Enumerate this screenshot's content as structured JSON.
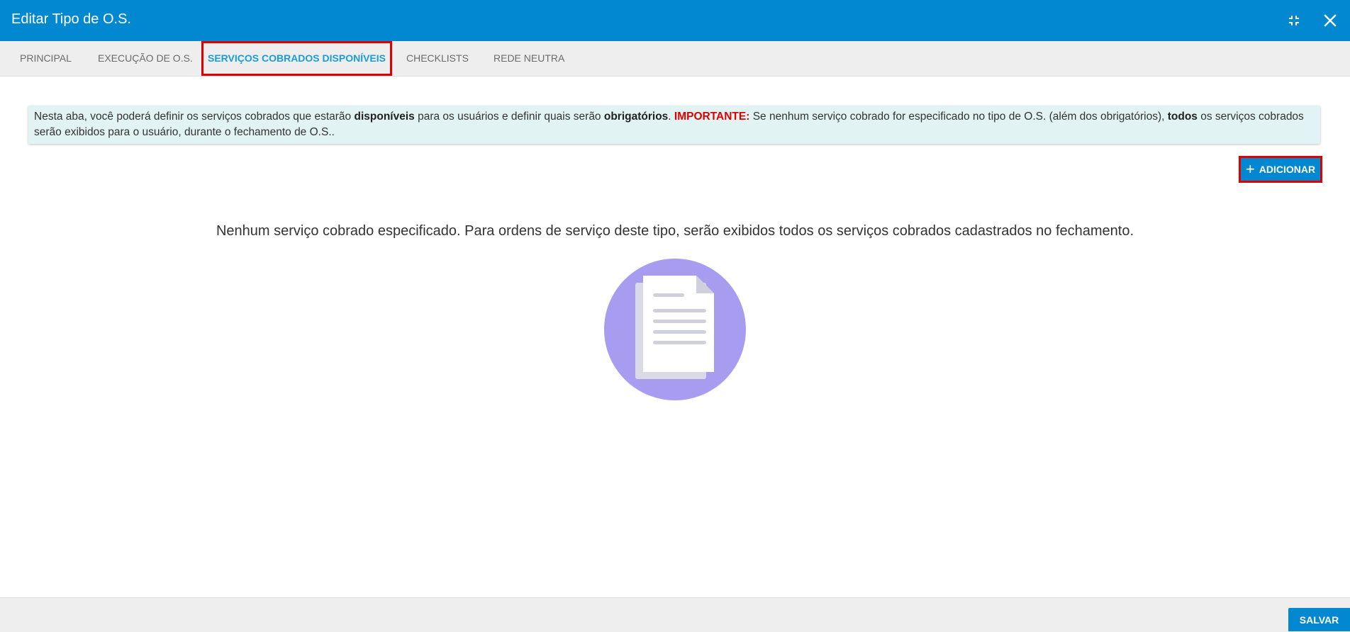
{
  "window": {
    "title": "Editar Tipo de O.S.",
    "minimize_icon": "collapse-icon",
    "close_icon": "close-icon"
  },
  "tabs": [
    {
      "label": "PRINCIPAL",
      "active": false
    },
    {
      "label": "EXECUÇÃO DE O.S.",
      "active": false
    },
    {
      "label": "SERVIÇOS COBRADOS DISPONÍVEIS",
      "active": true
    },
    {
      "label": "CHECKLISTS",
      "active": false
    },
    {
      "label": "REDE NEUTRA",
      "active": false
    }
  ],
  "info": {
    "part1": "Nesta aba, você poderá definir os serviços cobrados que estarão ",
    "bold1": "disponíveis",
    "part2": " para os usuários e definir quais serão ",
    "bold2": "obrigatórios",
    "part3": ". ",
    "important": "IMPORTANTE:",
    "part4": " Se nenhum serviço cobrado for especificado no tipo de O.S. (além dos obrigatórios), ",
    "bold3": "todos",
    "part5": " os serviços cobrados serão exibidos para o usuário, durante o fechamento de O.S.."
  },
  "actions": {
    "add_label": "ADICIONAR",
    "add_icon": "plus-icon"
  },
  "empty_state": {
    "message": "Nenhum serviço cobrado especificado. Para ordens de serviço deste tipo, serão exibidos todos os serviços cobrados cadastrados no fechamento.",
    "illustration_icon": "document-icon"
  },
  "footer": {
    "save_label": "SALVAR"
  },
  "colors": {
    "primary": "#0288d1",
    "highlight": "#e00000",
    "active_tab_text": "#1a9cd8",
    "info_bg": "#e2f3f3",
    "illustration_circle": "#a89cf0"
  }
}
